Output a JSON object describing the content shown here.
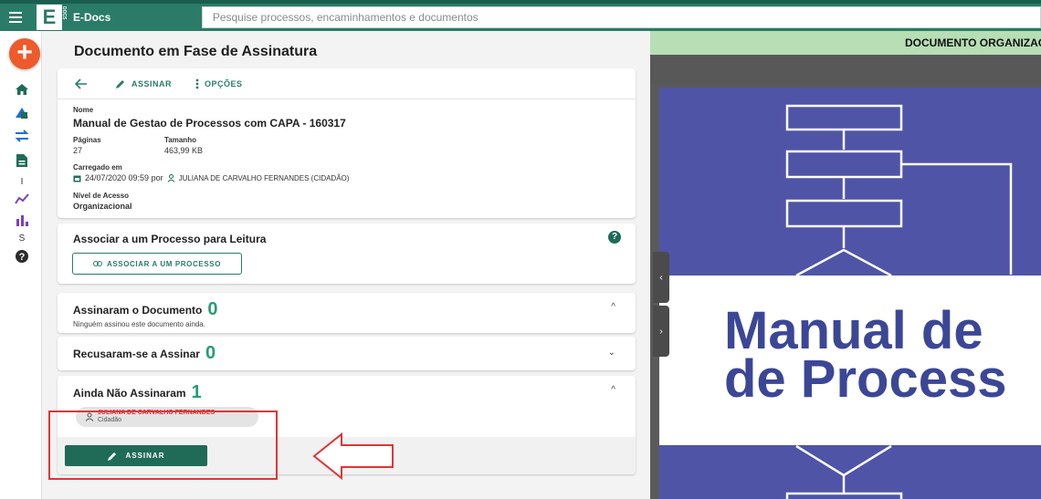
{
  "header": {
    "brand": "E-Docs",
    "logo_letter": "E",
    "logo_sub": "DOCS",
    "search_placeholder": "Pesquise processos, encaminhamentos e documentos"
  },
  "rail": {
    "fab_label": "+",
    "text_items": [
      "I",
      "S"
    ],
    "icons": [
      "home-icon",
      "shapes-icon",
      "swap-icon",
      "document-icon",
      "trend-icon",
      "bar-chart-icon",
      "help-icon"
    ]
  },
  "page": {
    "title": "Documento em Fase de Assinatura"
  },
  "toolbar": {
    "sign_label": "ASSINAR",
    "options_label": "OPÇÕES"
  },
  "details": {
    "name_label": "Nome",
    "name_value": "Manual de Gestao de Processos com CAPA - 160317",
    "pages_label": "Páginas",
    "pages_value": "27",
    "size_label": "Tamanho",
    "size_value": "463,99 KB",
    "uploaded_label": "Carregado em",
    "uploaded_value": "24/07/2020 09:59 por",
    "uploader": "JULIANA DE CARVALHO FERNANDES (CIDADÃO)",
    "access_label": "Nível de Acesso",
    "access_value": "Organizacional"
  },
  "associate": {
    "title": "Associar a um Processo para Leitura",
    "button_label": "ASSOCIAR A UM PROCESSO",
    "help": "?"
  },
  "signed": {
    "title": "Assinaram o Documento",
    "count": "0",
    "empty_text": "Ninguém assinou este documento ainda."
  },
  "refused": {
    "title": "Recusaram-se a Assinar",
    "count": "0"
  },
  "pending": {
    "title": "Ainda Não Assinaram",
    "count": "1",
    "person_name": "JULIANA DE CARVALHO FERNANDES",
    "person_role": "Cidadão",
    "sign_button_label": "ASSINAR"
  },
  "viewer": {
    "banner": "DOCUMENTO ORGANIZACIONAL",
    "doc_line1": "Manual de",
    "doc_line2": "de Process"
  },
  "colors": {
    "primary": "#2a7c68",
    "accent": "#ee5a2a",
    "count": "#2a9c74",
    "annotation": "#e03535"
  }
}
